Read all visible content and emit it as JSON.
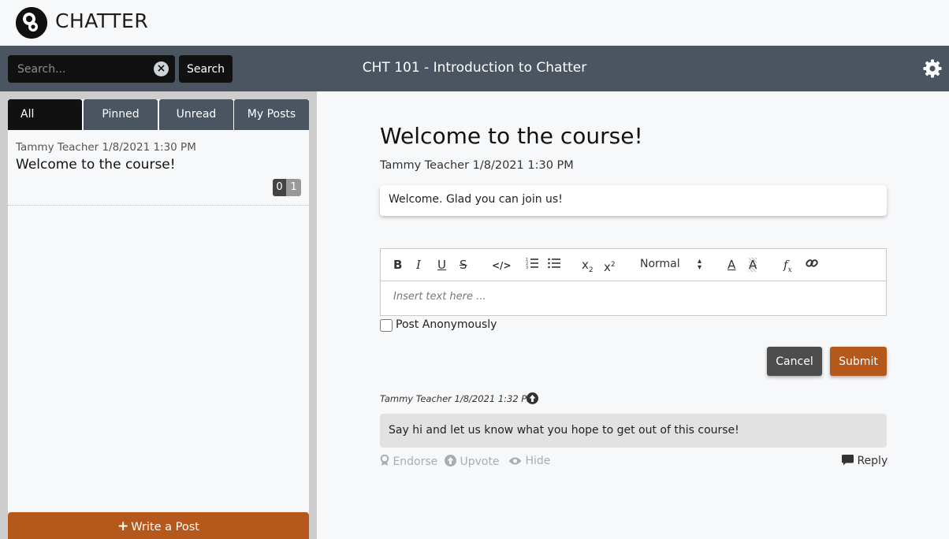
{
  "brand": {
    "name": "CHATTER"
  },
  "header": {
    "search_placeholder": "Search...",
    "search_button": "Search",
    "course_title": "CHT 101 - Introduction to Chatter"
  },
  "sidebar": {
    "tabs": [
      {
        "label": "All",
        "active": true
      },
      {
        "label": "Pinned",
        "active": false
      },
      {
        "label": "Unread",
        "active": false
      },
      {
        "label": "My Posts",
        "active": false
      }
    ],
    "posts": [
      {
        "meta": "Tammy Teacher 1/8/2021 1:30 PM",
        "title": "Welcome to the course!",
        "count_a": "0",
        "count_b": "1"
      }
    ],
    "write_button": "Write a Post"
  },
  "main": {
    "title": "Welcome to the course!",
    "meta": "Tammy Teacher 1/8/2021 1:30 PM",
    "body": "Welcome. Glad you can join us!"
  },
  "editor": {
    "format_select": "Normal",
    "placeholder": "Insert text here ...",
    "anonymous_label": "Post Anonymously",
    "cancel_label": "Cancel",
    "submit_label": "Submit"
  },
  "reply": {
    "meta": "Tammy Teacher 1/8/2021 1:32 PM",
    "body": "Say hi and let us know what you hope to get out of this course!",
    "actions": {
      "endorse": "Endorse",
      "upvote": "Upvote",
      "hide": "Hide",
      "reply": "Reply"
    }
  },
  "colors": {
    "header": "#4a5561",
    "accent": "#b5581c",
    "dark": "#111111"
  }
}
